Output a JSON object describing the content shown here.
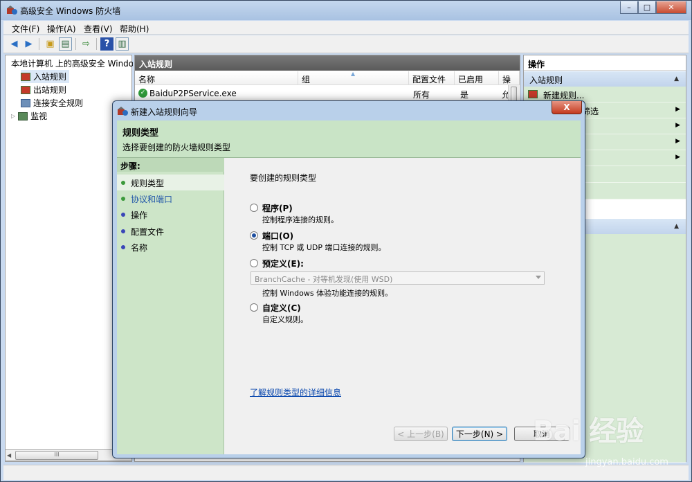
{
  "window": {
    "title": "高级安全 Windows 防火墙",
    "min_label": "–",
    "max_label": "□",
    "close_label": "✕"
  },
  "menu": [
    {
      "label": "文件(F)"
    },
    {
      "label": "操作(A)"
    },
    {
      "label": "查看(V)"
    },
    {
      "label": "帮助(H)"
    }
  ],
  "toolbar": {
    "back_icon": "arrow-left-icon",
    "forward_icon": "arrow-right-icon"
  },
  "tree": {
    "root": "本地计算机 上的高级安全 Windows 防火墙",
    "items": [
      {
        "label": "入站规则",
        "selected": true
      },
      {
        "label": "出站规则"
      },
      {
        "label": "连接安全规则"
      },
      {
        "label": "监视"
      }
    ],
    "hscroll_thumb": "III"
  },
  "center": {
    "header": "入站规则",
    "columns": [
      "名称",
      "组",
      "配置文件",
      "已启用",
      "操"
    ],
    "rows": [
      {
        "name": "BaiduP2PService.exe",
        "group": "",
        "profile": "所有",
        "enabled": "是",
        "action": "允"
      }
    ]
  },
  "actions": {
    "title": "操作",
    "section1": "入站规则",
    "items": [
      {
        "label": "新建规则..."
      },
      {
        "label": "筛选"
      },
      {
        "label": ""
      },
      {
        "label": ""
      },
      {
        "label": ""
      }
    ]
  },
  "dialog": {
    "title": "新建入站规则向导",
    "close_label": "X",
    "header_title": "规则类型",
    "header_subtitle": "选择要创建的防火墙规则类型",
    "steps_heading": "步骤:",
    "steps": [
      {
        "label": "规则类型",
        "color": "#3c9a3c"
      },
      {
        "label": "协议和端口",
        "color": "#3c9a3c"
      },
      {
        "label": "操作",
        "color": "#3a46b8"
      },
      {
        "label": "配置文件",
        "color": "#3a46b8"
      },
      {
        "label": "名称",
        "color": "#3a46b8"
      }
    ],
    "prompt": "要创建的规则类型",
    "options": [
      {
        "label": "程序(P)",
        "desc": "控制程序连接的规则。",
        "selected": false
      },
      {
        "label": "端口(O)",
        "desc": "控制 TCP 或 UDP 端口连接的规则。",
        "selected": true
      },
      {
        "label": "预定义(E):",
        "desc": "控制 Windows 体验功能连接的规则。",
        "selected": false
      },
      {
        "label": "自定义(C)",
        "desc": "自定义规则。",
        "selected": false
      }
    ],
    "predefined_value": "BranchCache - 对等机发现(使用 WSD)",
    "learn_more_link": "了解规则类型的详细信息",
    "back_button": "< 上一步(B)",
    "next_button": "下一步(N) >",
    "cancel_button": "取消"
  },
  "watermark": {
    "logo": "Bai 经验",
    "url": "jingyan.baidu.com"
  }
}
